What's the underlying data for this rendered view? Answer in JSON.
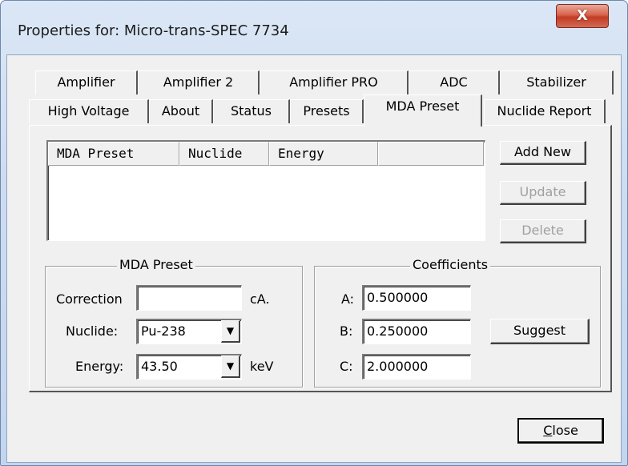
{
  "window": {
    "title": "Properties for: Micro-trans-SPEC 7734",
    "close_glyph": "X"
  },
  "tabs_row1": [
    {
      "label": "Amplifier"
    },
    {
      "label": "Amplifier 2"
    },
    {
      "label": "Amplifier PRO"
    },
    {
      "label": "ADC"
    },
    {
      "label": "Stabilizer"
    }
  ],
  "tabs_row2": [
    {
      "label": "High Voltage"
    },
    {
      "label": "About"
    },
    {
      "label": "Status"
    },
    {
      "label": "Presets"
    },
    {
      "label": "MDA Preset",
      "selected": true
    },
    {
      "label": "Nuclide Report"
    }
  ],
  "list": {
    "columns": [
      "MDA Preset",
      "Nuclide",
      "Energy",
      ""
    ]
  },
  "buttons": {
    "add_new": "Add New",
    "update": "Update",
    "delete": "Delete",
    "suggest": "Suggest",
    "close_first": "C",
    "close_rest": "lose"
  },
  "mda_group": {
    "title": "MDA Preset",
    "correction_label": "Correction",
    "correction_value": "",
    "correction_unit": "cA.",
    "nuclide_label": "Nuclide:",
    "nuclide_value": "Pu-238",
    "energy_label": "Energy:",
    "energy_value": "43.50",
    "energy_unit": "keV"
  },
  "coeff_group": {
    "title": "Coefficients",
    "a_label": "A:",
    "a_value": "0.500000",
    "b_label": "B:",
    "b_value": "0.250000",
    "c_label": "C:",
    "c_value": "2.000000"
  },
  "icons": {
    "dropdown": "▼"
  }
}
